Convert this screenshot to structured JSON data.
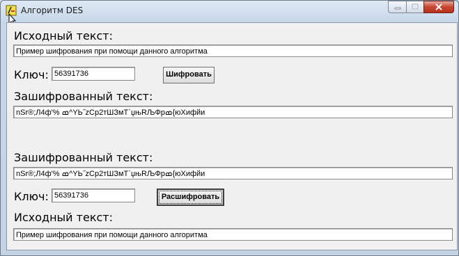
{
  "window": {
    "title": "Алгоритм DES"
  },
  "encrypt_section": {
    "source_label": "Исходный текст:",
    "source_value": "Пример шифрования при помощи данного алгоритма",
    "key_label": "Ключ:",
    "key_value": "56391736",
    "encrypt_button": "Шифровать",
    "result_label": "Зашифрованный текст:",
    "result_value": "nSr®;Л4ф'% ߘ^YЬ˝zCp2тШЗмТ΄џњRЉФрߘ{юХифйи"
  },
  "decrypt_section": {
    "cipher_label": "Зашифрованный текст:",
    "cipher_value": "nSr®;Л4ф'% ߘ^YЬ˝zCp2тШЗмТ΄џњRЉФрߘ{юХифйи",
    "key_label": "Ключ:",
    "key_value": "56391736",
    "decrypt_button": "Расшифровать",
    "result_label": "Исходный текст:",
    "result_value": "Пример шифрования при помощи данного алгоритма"
  }
}
